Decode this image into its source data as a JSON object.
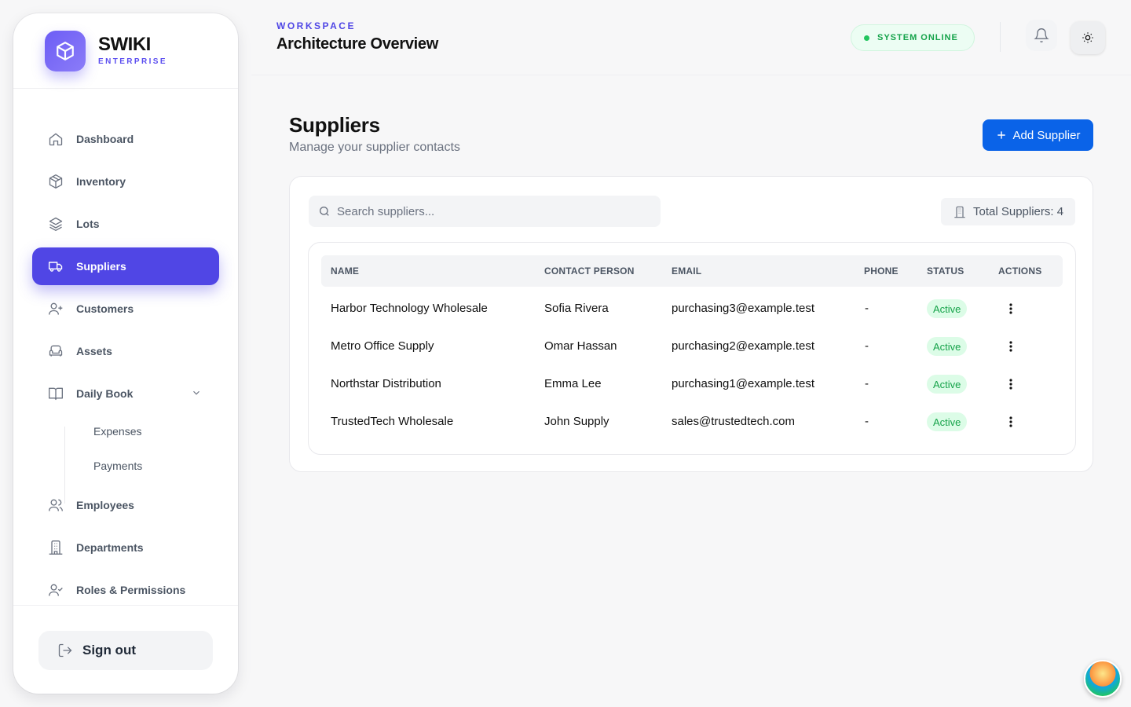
{
  "brand": {
    "name": "SWIKI",
    "subtitle": "ENTERPRISE"
  },
  "sidebar": {
    "items": [
      {
        "label": "Dashboard",
        "icon": "home-icon"
      },
      {
        "label": "Inventory",
        "icon": "package-icon"
      },
      {
        "label": "Lots",
        "icon": "layers-icon"
      },
      {
        "label": "Suppliers",
        "icon": "truck-icon",
        "active": true
      },
      {
        "label": "Customers",
        "icon": "user-plus-icon"
      },
      {
        "label": "Assets",
        "icon": "armchair-icon"
      },
      {
        "label": "Daily Book",
        "icon": "book-open-icon",
        "expanded": true
      },
      {
        "label": "Employees",
        "icon": "users-icon"
      },
      {
        "label": "Departments",
        "icon": "building-icon"
      },
      {
        "label": "Roles & Permissions",
        "icon": "user-check-icon"
      }
    ],
    "daily_book_sub": [
      "Expenses",
      "Payments"
    ],
    "signout_label": "Sign out"
  },
  "header": {
    "workspace_label": "WORKSPACE",
    "workspace_title": "Architecture Overview",
    "status": "SYSTEM ONLINE"
  },
  "page": {
    "title": "Suppliers",
    "subtitle": "Manage your supplier contacts",
    "add_button": "Add Supplier",
    "search_placeholder": "Search suppliers...",
    "total_label": "Total Suppliers: 4"
  },
  "table": {
    "columns": [
      "NAME",
      "CONTACT PERSON",
      "EMAIL",
      "PHONE",
      "STATUS",
      "ACTIONS"
    ],
    "rows": [
      {
        "name": "Harbor Technology Wholesale",
        "contact": "Sofia Rivera",
        "email": "purchasing3@example.test",
        "phone": "-",
        "status": "Active"
      },
      {
        "name": "Metro Office Supply",
        "contact": "Omar Hassan",
        "email": "purchasing2@example.test",
        "phone": "-",
        "status": "Active"
      },
      {
        "name": "Northstar Distribution",
        "contact": "Emma Lee",
        "email": "purchasing1@example.test",
        "phone": "-",
        "status": "Active"
      },
      {
        "name": "TrustedTech Wholesale",
        "contact": "John Supply",
        "email": "sales@trustedtech.com",
        "phone": "-",
        "status": "Active"
      }
    ]
  },
  "colors": {
    "accent": "#5046e5",
    "primary_button": "#0a63e8",
    "status_green": "#16a34a"
  }
}
